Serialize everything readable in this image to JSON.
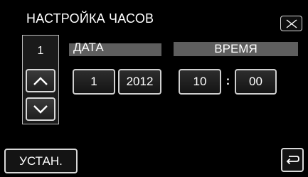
{
  "screen": {
    "title": "НАСТРОЙКА ЧАСОВ"
  },
  "stepper": {
    "value": "1"
  },
  "date": {
    "label": "ДАТА",
    "day": "1",
    "year": "2012"
  },
  "time": {
    "label": "ВРЕМЯ",
    "hour": "10",
    "separator": ":",
    "minute": "00"
  },
  "footer": {
    "set_label": "УСТАН."
  },
  "icons": {
    "close": "close-icon",
    "up": "chevron-up-icon",
    "down": "chevron-down-icon",
    "back": "return-arrow-icon"
  }
}
